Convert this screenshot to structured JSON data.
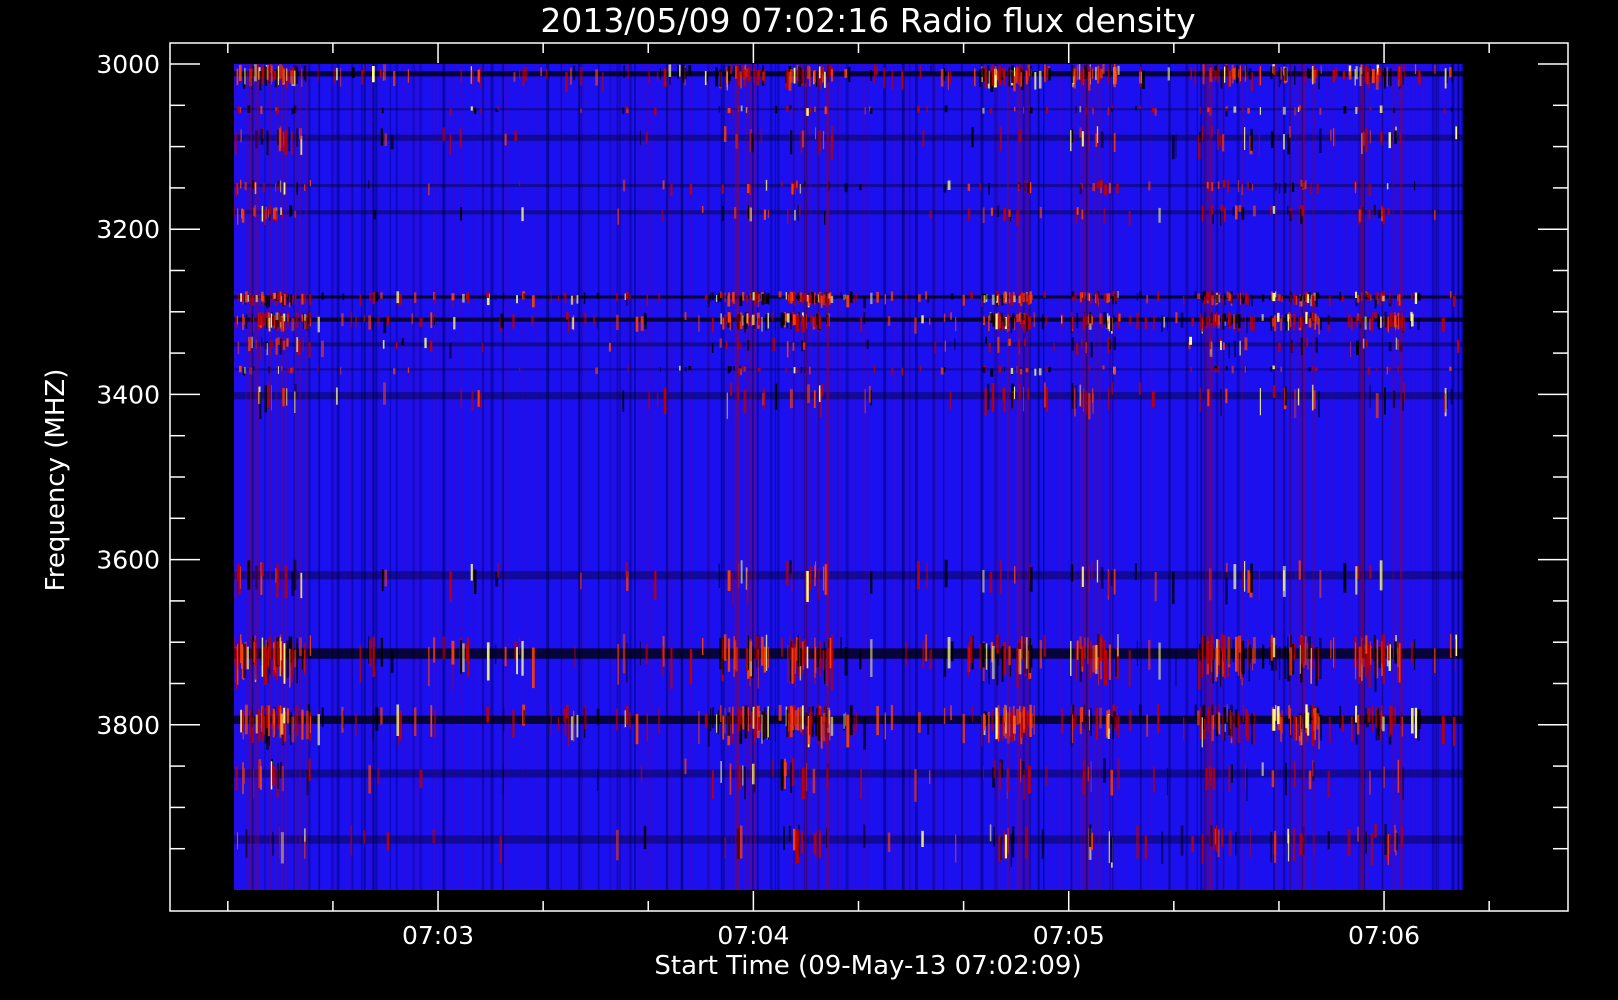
{
  "chart_data": {
    "type": "heatmap",
    "title": "2013/05/09 07:02:16 Radio flux density",
    "xlabel": "Start Time (09-May-13 07:02:09)",
    "ylabel": "Frequency (MHZ)",
    "x_range": [
      "07:02:09",
      "07:06:35"
    ],
    "data_x_extent": [
      "07:02:19",
      "07:06:15"
    ],
    "ylim": [
      3000,
      4000
    ],
    "y_inverted": true,
    "x_ticks": [
      "07:03",
      "07:04",
      "07:05",
      "07:06"
    ],
    "y_ticks": [
      3000,
      3200,
      3400,
      3600,
      3800
    ],
    "colormap": [
      "#000000",
      "#0000ff",
      "#c00000",
      "#ff4000",
      "#ffff80"
    ],
    "background_value_color": "#1a10f0",
    "bright_frequency_bands_mhz": [
      [
        3000,
        3025
      ],
      [
        3050,
        3060
      ],
      [
        3075,
        3105
      ],
      [
        3140,
        3155
      ],
      [
        3170,
        3190
      ],
      [
        3275,
        3290
      ],
      [
        3300,
        3320
      ],
      [
        3330,
        3350
      ],
      [
        3365,
        3375
      ],
      [
        3385,
        3420
      ],
      [
        3600,
        3640
      ],
      [
        3690,
        3740
      ],
      [
        3775,
        3815
      ],
      [
        3840,
        3880
      ],
      [
        3920,
        3960
      ]
    ],
    "burst_times": [
      "07:02:26",
      "07:02:31",
      "07:03:58",
      "07:04:10",
      "07:04:48",
      "07:05:05",
      "07:05:30",
      "07:05:43",
      "07:05:59"
    ],
    "grid": false
  }
}
